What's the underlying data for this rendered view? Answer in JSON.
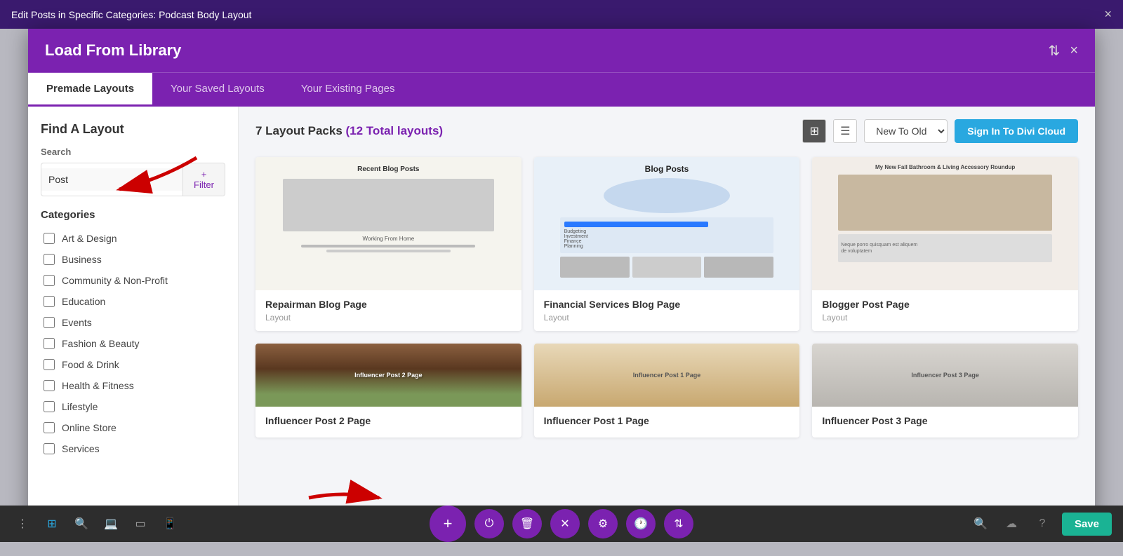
{
  "window": {
    "title": "Edit Posts in Specific Categories: Podcast Body Layout",
    "close_label": "×"
  },
  "modal": {
    "title": "Load From Library",
    "sort_icon": "⇅",
    "close_icon": "×"
  },
  "tabs": [
    {
      "label": "Premade Layouts",
      "active": true
    },
    {
      "label": "Your Saved Layouts",
      "active": false
    },
    {
      "label": "Your Existing Pages",
      "active": false
    }
  ],
  "sidebar": {
    "title": "Find A Layout",
    "search_label": "Search",
    "search_placeholder": "Post",
    "filter_label": "+ Filter",
    "categories_title": "Categories",
    "categories": [
      {
        "label": "Art & Design",
        "checked": false
      },
      {
        "label": "Business",
        "checked": false
      },
      {
        "label": "Community & Non-Profit",
        "checked": false
      },
      {
        "label": "Education",
        "checked": false
      },
      {
        "label": "Events",
        "checked": false
      },
      {
        "label": "Fashion & Beauty",
        "checked": false
      },
      {
        "label": "Food & Drink",
        "checked": false
      },
      {
        "label": "Health & Fitness",
        "checked": false
      },
      {
        "label": "Lifestyle",
        "checked": false
      },
      {
        "label": "Online Store",
        "checked": false
      },
      {
        "label": "Services",
        "checked": false
      }
    ]
  },
  "content": {
    "pack_count": "7 Layout Packs",
    "total_layouts": "(12 Total layouts)",
    "sort_value": "New To Old",
    "sign_in_label": "Sign In To Divi Cloud",
    "layouts": [
      {
        "name": "Repairman Blog Page",
        "type": "Layout",
        "thumb_title": "Recent Blog Posts",
        "thumb_style": "repairman"
      },
      {
        "name": "Financial Services Blog Page",
        "type": "Layout",
        "thumb_title": "Blog Posts",
        "thumb_style": "financial"
      },
      {
        "name": "Blogger Post Page",
        "type": "Layout",
        "thumb_title": "My New Fall Bathroom & Living Accessory Roundup",
        "thumb_style": "blogger"
      },
      {
        "name": "Influencer Post 2 Page",
        "type": "",
        "thumb_title": "",
        "thumb_style": "influencer2"
      },
      {
        "name": "Influencer Post 1 Page",
        "type": "",
        "thumb_title": "",
        "thumb_style": "influencer1"
      },
      {
        "name": "Influencer Post 3 Page",
        "type": "",
        "thumb_title": "",
        "thumb_style": "influencer3"
      }
    ]
  },
  "toolbar": {
    "left_icons": [
      "⋮",
      "⊞",
      "🔍",
      "💻",
      "▭",
      "📱"
    ],
    "center_buttons": [
      {
        "icon": "+",
        "style": "larger",
        "label": "add"
      },
      {
        "icon": "⏻",
        "style": "purple",
        "label": "power"
      },
      {
        "icon": "🗑",
        "style": "purple",
        "label": "delete"
      },
      {
        "icon": "✕",
        "style": "purple",
        "label": "close"
      },
      {
        "icon": "⚙",
        "style": "purple",
        "label": "settings"
      },
      {
        "icon": "🕐",
        "style": "purple",
        "label": "history"
      },
      {
        "icon": "⇅",
        "style": "purple",
        "label": "sort"
      }
    ],
    "right_icons": [
      "🔍",
      "☁",
      "?"
    ],
    "save_label": "Save"
  }
}
